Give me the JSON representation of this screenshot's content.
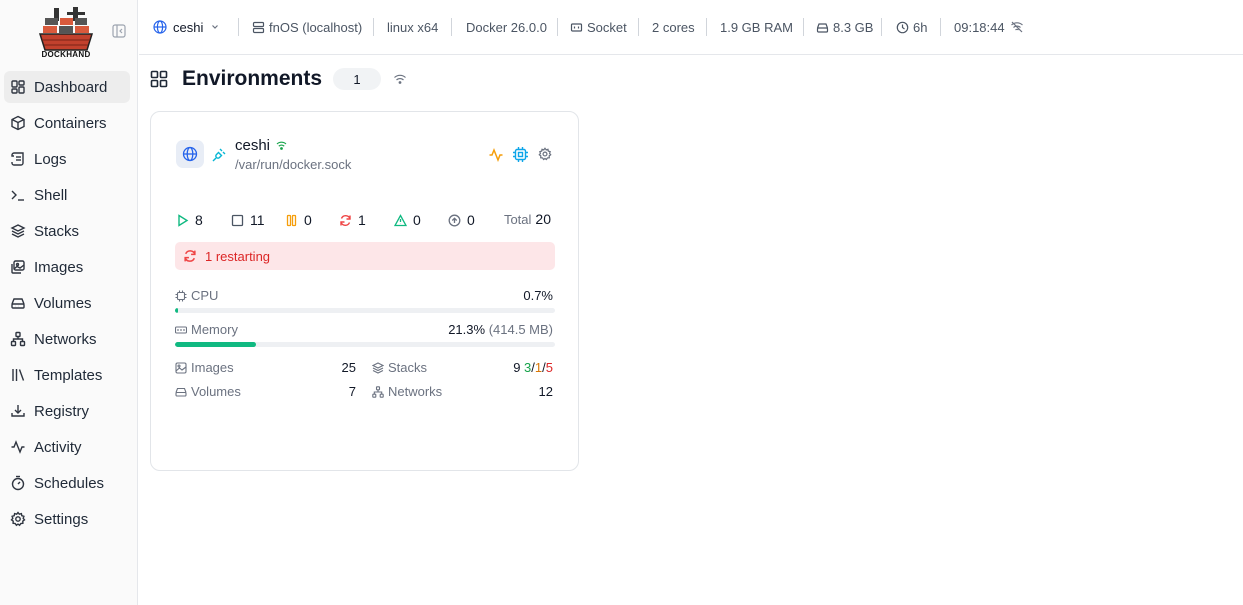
{
  "app": {
    "logo_text": "DOCKHAND"
  },
  "sidebar": {
    "items": [
      {
        "label": "Dashboard",
        "icon": "dashboard-icon",
        "active": true
      },
      {
        "label": "Containers",
        "icon": "box-icon"
      },
      {
        "label": "Logs",
        "icon": "scroll-icon"
      },
      {
        "label": "Shell",
        "icon": "terminal-icon"
      },
      {
        "label": "Stacks",
        "icon": "layers-icon"
      },
      {
        "label": "Images",
        "icon": "images-icon"
      },
      {
        "label": "Volumes",
        "icon": "hard-drive-icon"
      },
      {
        "label": "Networks",
        "icon": "network-icon"
      },
      {
        "label": "Templates",
        "icon": "library-icon"
      },
      {
        "label": "Registry",
        "icon": "download-icon"
      },
      {
        "label": "Activity",
        "icon": "activity-icon"
      },
      {
        "label": "Schedules",
        "icon": "timer-icon"
      },
      {
        "label": "Settings",
        "icon": "gear-icon"
      }
    ]
  },
  "topbar": {
    "env": "ceshi",
    "host": "fnOS (localhost)",
    "platform": "linux x64",
    "docker": "Docker 26.0.0",
    "connection": "Socket",
    "cores": "2 cores",
    "ram": "1.9 GB RAM",
    "disk": "8.3 GB",
    "uptime": "6h",
    "time": "09:18:44"
  },
  "page": {
    "title": "Environments",
    "count": "1"
  },
  "card": {
    "name": "ceshi",
    "path": "/var/run/docker.sock",
    "stats": {
      "running": "8",
      "stopped": "11",
      "paused": "0",
      "restarting": "1",
      "unhealthy": "0",
      "updates": "0",
      "total_label": "Total",
      "total": "20"
    },
    "alert": "1 restarting",
    "cpu": {
      "label": "CPU",
      "value": "0.7%",
      "fraction": 0.007
    },
    "memory": {
      "label": "Memory",
      "value": "21.3%",
      "detail": "(414.5 MB)",
      "fraction": 0.213
    },
    "resources": {
      "images_label": "Images",
      "images": "25",
      "stacks_label": "Stacks",
      "stacks_total": "9",
      "stacks_running": "3",
      "stacks_partial": "1",
      "stacks_stopped": "5",
      "volumes_label": "Volumes",
      "volumes": "7",
      "networks_label": "Networks",
      "networks": "12"
    }
  },
  "colors": {
    "accent": "#2563eb",
    "success": "#10b981",
    "danger": "#ef4444",
    "warning": "#f59e0b",
    "info": "#06b6d4"
  }
}
